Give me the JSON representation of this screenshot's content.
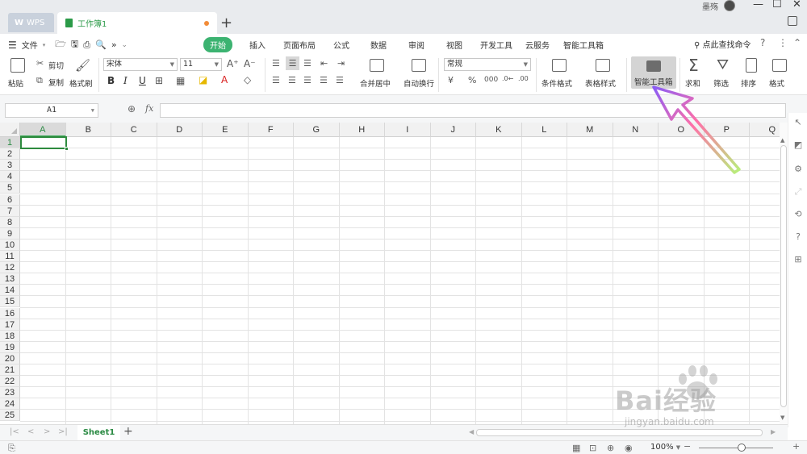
{
  "titlebar": {
    "wps_tab": "WPS",
    "doc_tab": "工作簿1",
    "new_tab": "+",
    "user": "墨殇"
  },
  "menu": {
    "file": "文件",
    "tabs": [
      "开始",
      "插入",
      "页面布局",
      "公式",
      "数据",
      "审阅",
      "视图",
      "开发工具",
      "云服务",
      "智能工具箱"
    ],
    "active_tab": "开始",
    "search_cmd": "点此查找命令"
  },
  "ribbon": {
    "paste": "粘贴",
    "cut": "剪切",
    "copy": "复制",
    "format_painter": "格式刷",
    "font_name": "宋体",
    "font_size": "11",
    "merge_center": "合并居中",
    "wrap_text": "自动换行",
    "number_format": "常规",
    "conditional_format": "条件格式",
    "table_style": "表格样式",
    "smart_toolbox": "智能工具箱",
    "sum": "求和",
    "filter": "筛选",
    "sort": "排序",
    "format": "格式"
  },
  "formula_bar": {
    "name_box": "A1",
    "fx": "fx",
    "formula": ""
  },
  "grid": {
    "columns": [
      "A",
      "B",
      "C",
      "D",
      "E",
      "F",
      "G",
      "H",
      "I",
      "J",
      "K",
      "L",
      "M",
      "N",
      "O",
      "P",
      "Q"
    ],
    "rows": [
      "1",
      "2",
      "3",
      "4",
      "5",
      "6",
      "7",
      "8",
      "9",
      "10",
      "11",
      "12",
      "13",
      "14",
      "15",
      "16",
      "17",
      "18",
      "19",
      "20",
      "21",
      "22",
      "23",
      "24",
      "25"
    ],
    "selected_cell": "A1"
  },
  "sheets": {
    "tabs": [
      "Sheet1"
    ],
    "active": "Sheet1",
    "add": "+"
  },
  "status": {
    "zoom": "100%",
    "zoom_level": 1.0
  },
  "watermark": {
    "main": "Bai经验",
    "sub": "jingyan.baidu.com"
  },
  "annotation": {
    "arrow_color_start": "#8a5cf6",
    "arrow_color_end": "#b7f07a"
  }
}
